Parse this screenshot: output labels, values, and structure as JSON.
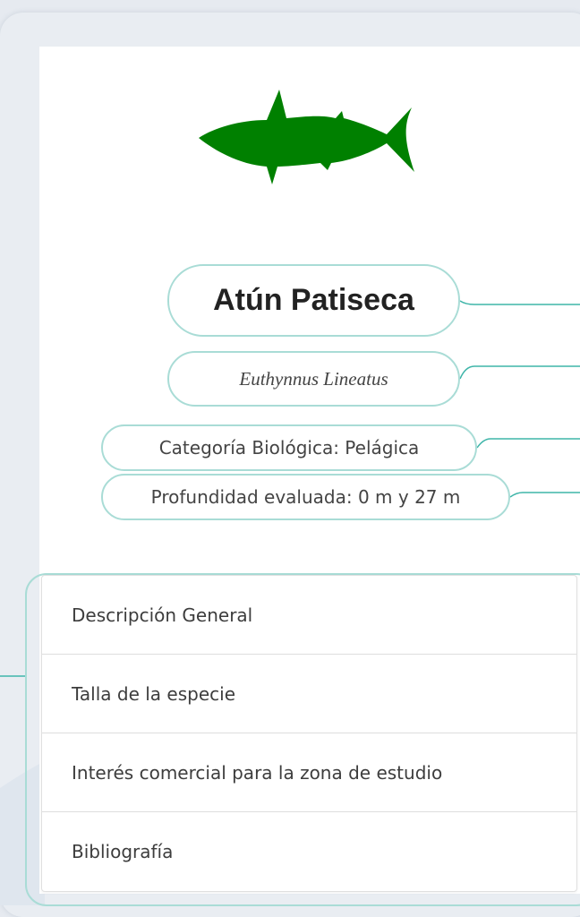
{
  "species": {
    "common_name": "Atún Patiseca",
    "scientific_name": "Euthynnus Lineatus",
    "category": "Categoría Biológica: Pelágica",
    "depth": "Profundidad evaluada: 0 m y 27 m"
  },
  "icon": {
    "name": "tuna-fish-icon",
    "color": "#008000"
  },
  "colors": {
    "accent": "#a9dcd6",
    "line": "#3fb5a9"
  },
  "sections": [
    {
      "label": "Descripción General"
    },
    {
      "label": "Talla de la especie"
    },
    {
      "label": "Interés comercial para la zona de estudio"
    },
    {
      "label": "Bibliografía"
    }
  ]
}
